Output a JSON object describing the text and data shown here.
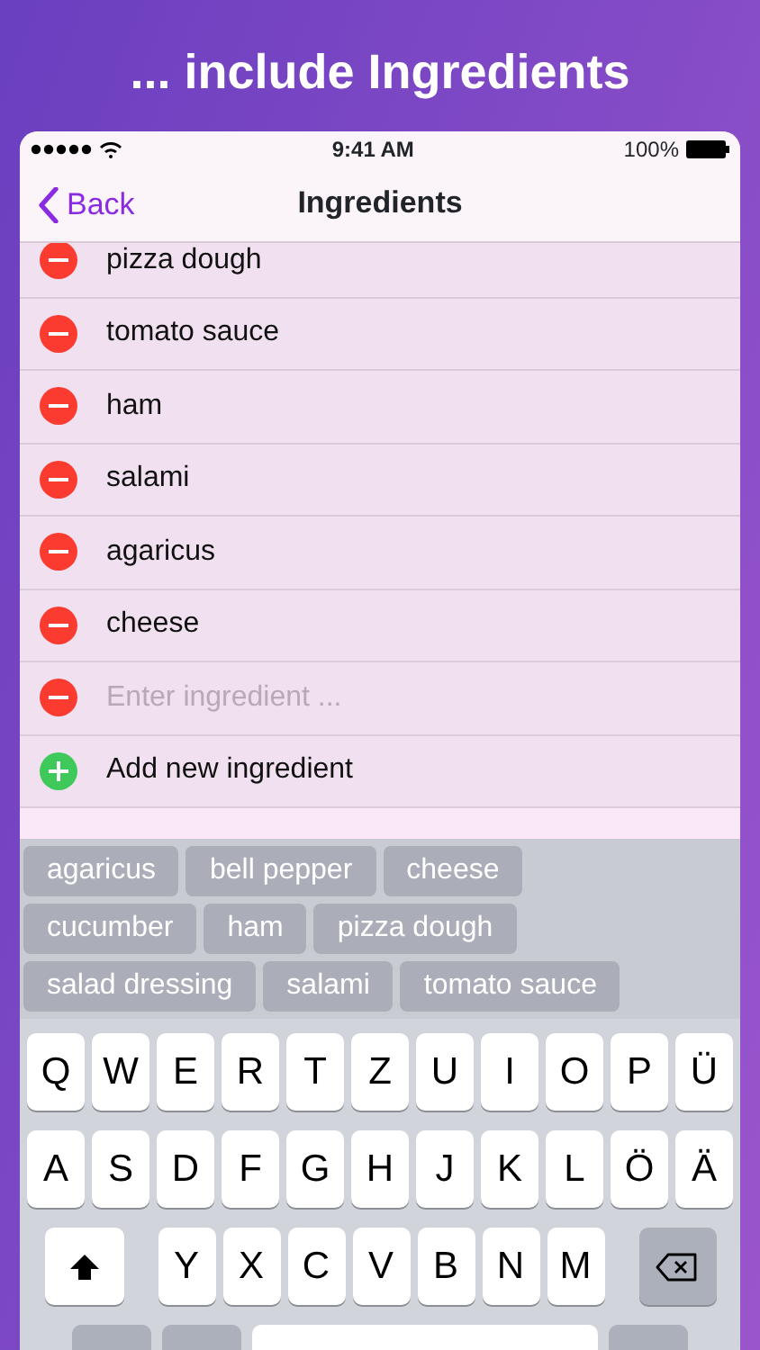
{
  "headline": "... include Ingredients",
  "status_bar": {
    "time": "9:41 AM",
    "battery": "100%"
  },
  "nav": {
    "back": "Back",
    "title": "Ingredients"
  },
  "ingredients": [
    {
      "name": "pizza dough"
    },
    {
      "name": "tomato sauce"
    },
    {
      "name": "ham"
    },
    {
      "name": "salami"
    },
    {
      "name": "agaricus"
    },
    {
      "name": "cheese"
    }
  ],
  "entry": {
    "placeholder": "Enter ingredient ..."
  },
  "add_label": "Add new ingredient",
  "suggestions": [
    [
      "agaricus",
      "bell pepper",
      "cheese"
    ],
    [
      "cucumber",
      "ham",
      "pizza dough"
    ],
    [
      "salad dressing",
      "salami",
      "tomato sauce"
    ]
  ],
  "keyboard": [
    [
      {
        "kind": "letter",
        "label": "Q"
      },
      {
        "kind": "letter",
        "label": "W"
      },
      {
        "kind": "letter",
        "label": "E"
      },
      {
        "kind": "letter",
        "label": "R"
      },
      {
        "kind": "letter",
        "label": "T"
      },
      {
        "kind": "letter",
        "label": "Z"
      },
      {
        "kind": "letter",
        "label": "U"
      },
      {
        "kind": "letter",
        "label": "I"
      },
      {
        "kind": "letter",
        "label": "O"
      },
      {
        "kind": "letter",
        "label": "P"
      },
      {
        "kind": "letter",
        "label": "Ü"
      }
    ],
    [
      {
        "kind": "letter",
        "label": "A"
      },
      {
        "kind": "letter",
        "label": "S"
      },
      {
        "kind": "letter",
        "label": "D"
      },
      {
        "kind": "letter",
        "label": "F"
      },
      {
        "kind": "letter",
        "label": "G"
      },
      {
        "kind": "letter",
        "label": "H"
      },
      {
        "kind": "letter",
        "label": "J"
      },
      {
        "kind": "letter",
        "label": "K"
      },
      {
        "kind": "letter",
        "label": "L"
      },
      {
        "kind": "letter",
        "label": "Ö"
      },
      {
        "kind": "letter",
        "label": "Ä"
      }
    ],
    [
      {
        "kind": "shift"
      },
      {
        "kind": "letter",
        "label": "Y"
      },
      {
        "kind": "letter",
        "label": "X"
      },
      {
        "kind": "letter",
        "label": "C"
      },
      {
        "kind": "letter",
        "label": "V"
      },
      {
        "kind": "letter",
        "label": "B"
      },
      {
        "kind": "letter",
        "label": "N"
      },
      {
        "kind": "letter",
        "label": "M"
      },
      {
        "kind": "backspace"
      }
    ],
    [
      {
        "kind": "blank"
      },
      {
        "kind": "blank"
      },
      {
        "kind": "space"
      },
      {
        "kind": "blank"
      }
    ]
  ]
}
